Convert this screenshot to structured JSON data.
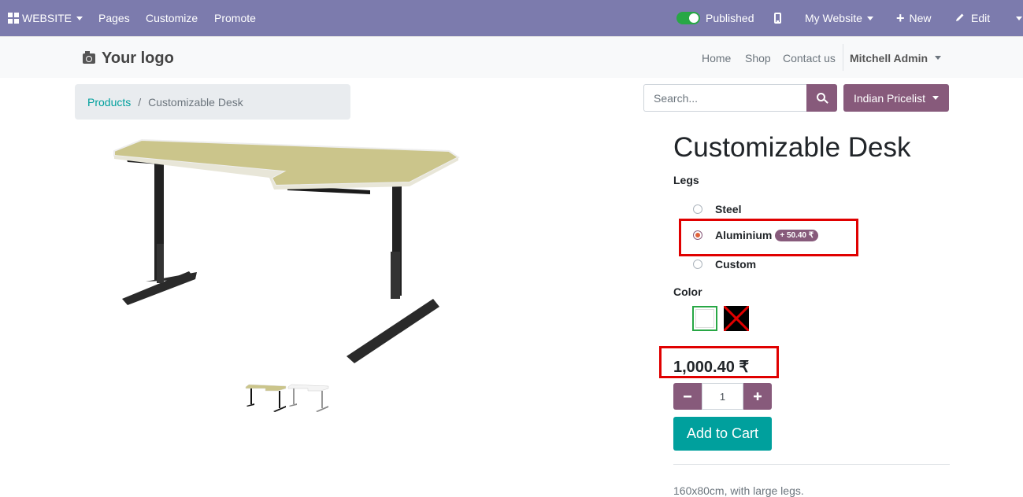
{
  "admin_bar": {
    "website_menu": "WEBSITE",
    "pages": "Pages",
    "customize": "Customize",
    "promote": "Promote",
    "published_label": "Published",
    "my_website": "My Website",
    "new_label": "New",
    "edit_label": "Edit",
    "colors": {
      "background": "#7c7bad",
      "toggle_on": "#28a745"
    }
  },
  "site_header": {
    "logo_text": "Your logo",
    "nav": [
      "Home",
      "Shop",
      "Contact us"
    ],
    "user": "Mitchell Admin"
  },
  "breadcrumb": {
    "parent": "Products",
    "separator": "/",
    "current": "Customizable Desk"
  },
  "search": {
    "placeholder": "Search..."
  },
  "pricelist": {
    "label": "Indian Pricelist"
  },
  "product": {
    "name": "Customizable Desk",
    "attributes": {
      "legs_label": "Legs",
      "legs_options": [
        {
          "label": "Steel",
          "selected": false
        },
        {
          "label": "Aluminium",
          "selected": true,
          "extra_price": "+ 50.40 ₹"
        },
        {
          "label": "Custom",
          "selected": false
        }
      ],
      "color_label": "Color",
      "colors": [
        {
          "name": "White",
          "hex": "#ffffff",
          "selected": true
        },
        {
          "name": "Black",
          "hex": "#000000",
          "selected": false,
          "unavailable": true
        }
      ]
    },
    "price": "1,000.40 ₹",
    "quantity": "1",
    "add_to_cart": "Add to Cart",
    "description": "160x80cm, with large legs."
  },
  "theme_colors": {
    "primary": "#875a7b",
    "secondary": "#00a09d",
    "highlight": "#e00000"
  }
}
